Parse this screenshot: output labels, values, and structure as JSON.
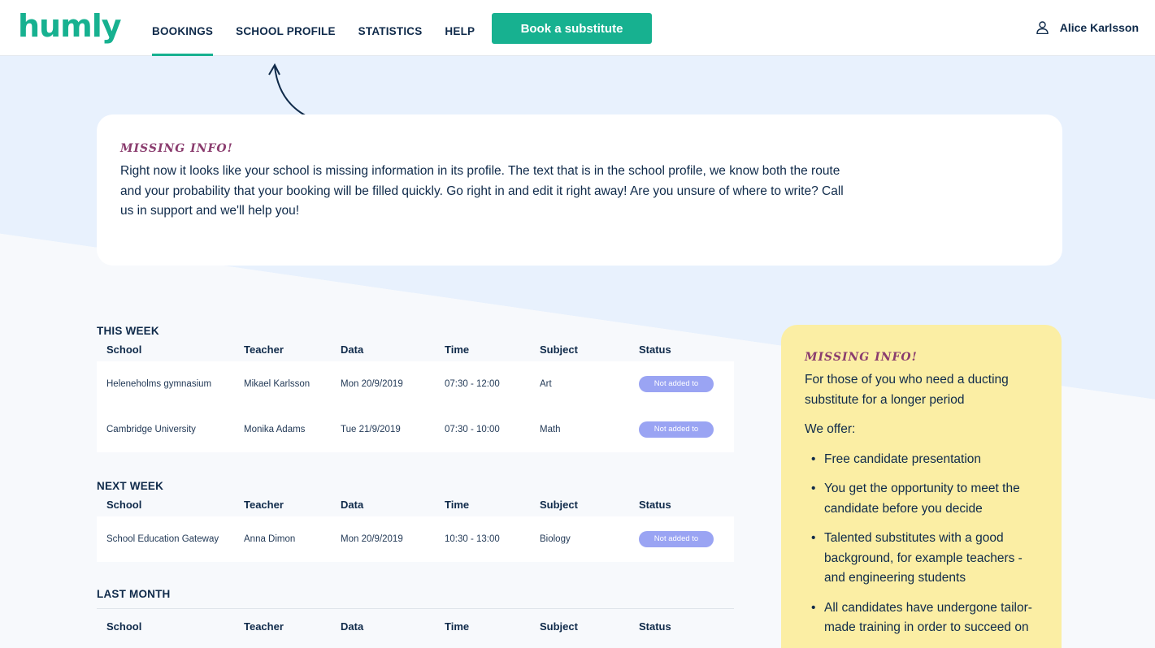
{
  "brand": {
    "logo": "humly",
    "accent": "#17b190"
  },
  "nav": {
    "items": [
      "BOOKINGS",
      "SCHOOL PROFILE",
      "STATISTICS",
      "HELP"
    ],
    "active": "BOOKINGS"
  },
  "header": {
    "book_button": "Book a substitute",
    "user_name": "Alice Karlsson"
  },
  "info_card": {
    "title": "MISSING INFO!",
    "text": "Right now it looks like your school is missing information in its profile. The text that is in the school profile, we know both the route and your probability that your booking will be filled quickly. Go right in and edit it right away! Are you unsure of where to write? Call us in support and we'll help you!"
  },
  "columns": [
    "School",
    "Teacher",
    "Data",
    "Time",
    "Subject",
    "Status"
  ],
  "sections": [
    {
      "title": "THIS WEEK",
      "rows": [
        [
          "Heleneholms gymnasium",
          "Mikael Karlsson",
          "Mon 20/9/2019",
          "07:30 - 12:00",
          "Art",
          "Not added to"
        ],
        [
          "Cambridge University",
          "Monika Adams",
          "Tue 21/9/2019",
          "07:30 - 10:00",
          "Math",
          "Not added to"
        ]
      ]
    },
    {
      "title": "NEXT WEEK",
      "rows": [
        [
          "School Education Gateway",
          "Anna Dimon",
          "Mon 20/9/2019",
          "10:30 - 13:00",
          "Biology",
          "Not added to"
        ]
      ]
    },
    {
      "title": "LAST MONTH",
      "rows": []
    }
  ],
  "yellow_card": {
    "title": "MISSING INFO!",
    "intro": "For those of you who need a ducting substitute for a longer period",
    "offer": "We offer:",
    "bullets": [
      "Free candidate presentation",
      "You get the opportunity to meet the candidate before you decide",
      "Talented substitutes with a good background, for example teachers - and engineering students",
      "All candidates have undergone tailor-made training in order to succeed on"
    ]
  }
}
